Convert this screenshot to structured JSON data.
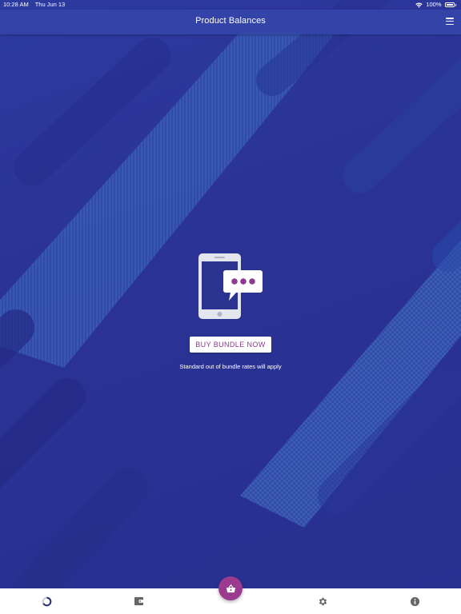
{
  "status_bar": {
    "time": "10:28 AM",
    "date": "Thu Jun 13",
    "battery": "100%",
    "icons": [
      "wifi-icon",
      "battery-icon"
    ]
  },
  "nav_bar": {
    "title": "Product Balances",
    "menu_icon": "hamburger-menu-icon"
  },
  "empty_state": {
    "illustration_icon": "phone-chat-bubble-icon",
    "button_label": "BUY BUNDLE NOW",
    "note": "Standard out of bundle rates will apply"
  },
  "tab_bar": {
    "tabs": [
      {
        "icon": "balances-ring-icon",
        "active": true
      },
      {
        "icon": "wallet-icon",
        "active": false
      },
      {
        "icon": "shop-basket-icon",
        "active": false,
        "floating": true
      },
      {
        "icon": "gear-icon",
        "active": false
      },
      {
        "icon": "info-icon",
        "active": false
      }
    ]
  },
  "colors": {
    "background": "#2b3496",
    "nav_bar": "#3444a8",
    "accent": "#9b3a8e",
    "button_text": "#8e3a8f",
    "tab_icon": "#666666",
    "active_tab_icon": "#2a2f6e"
  }
}
